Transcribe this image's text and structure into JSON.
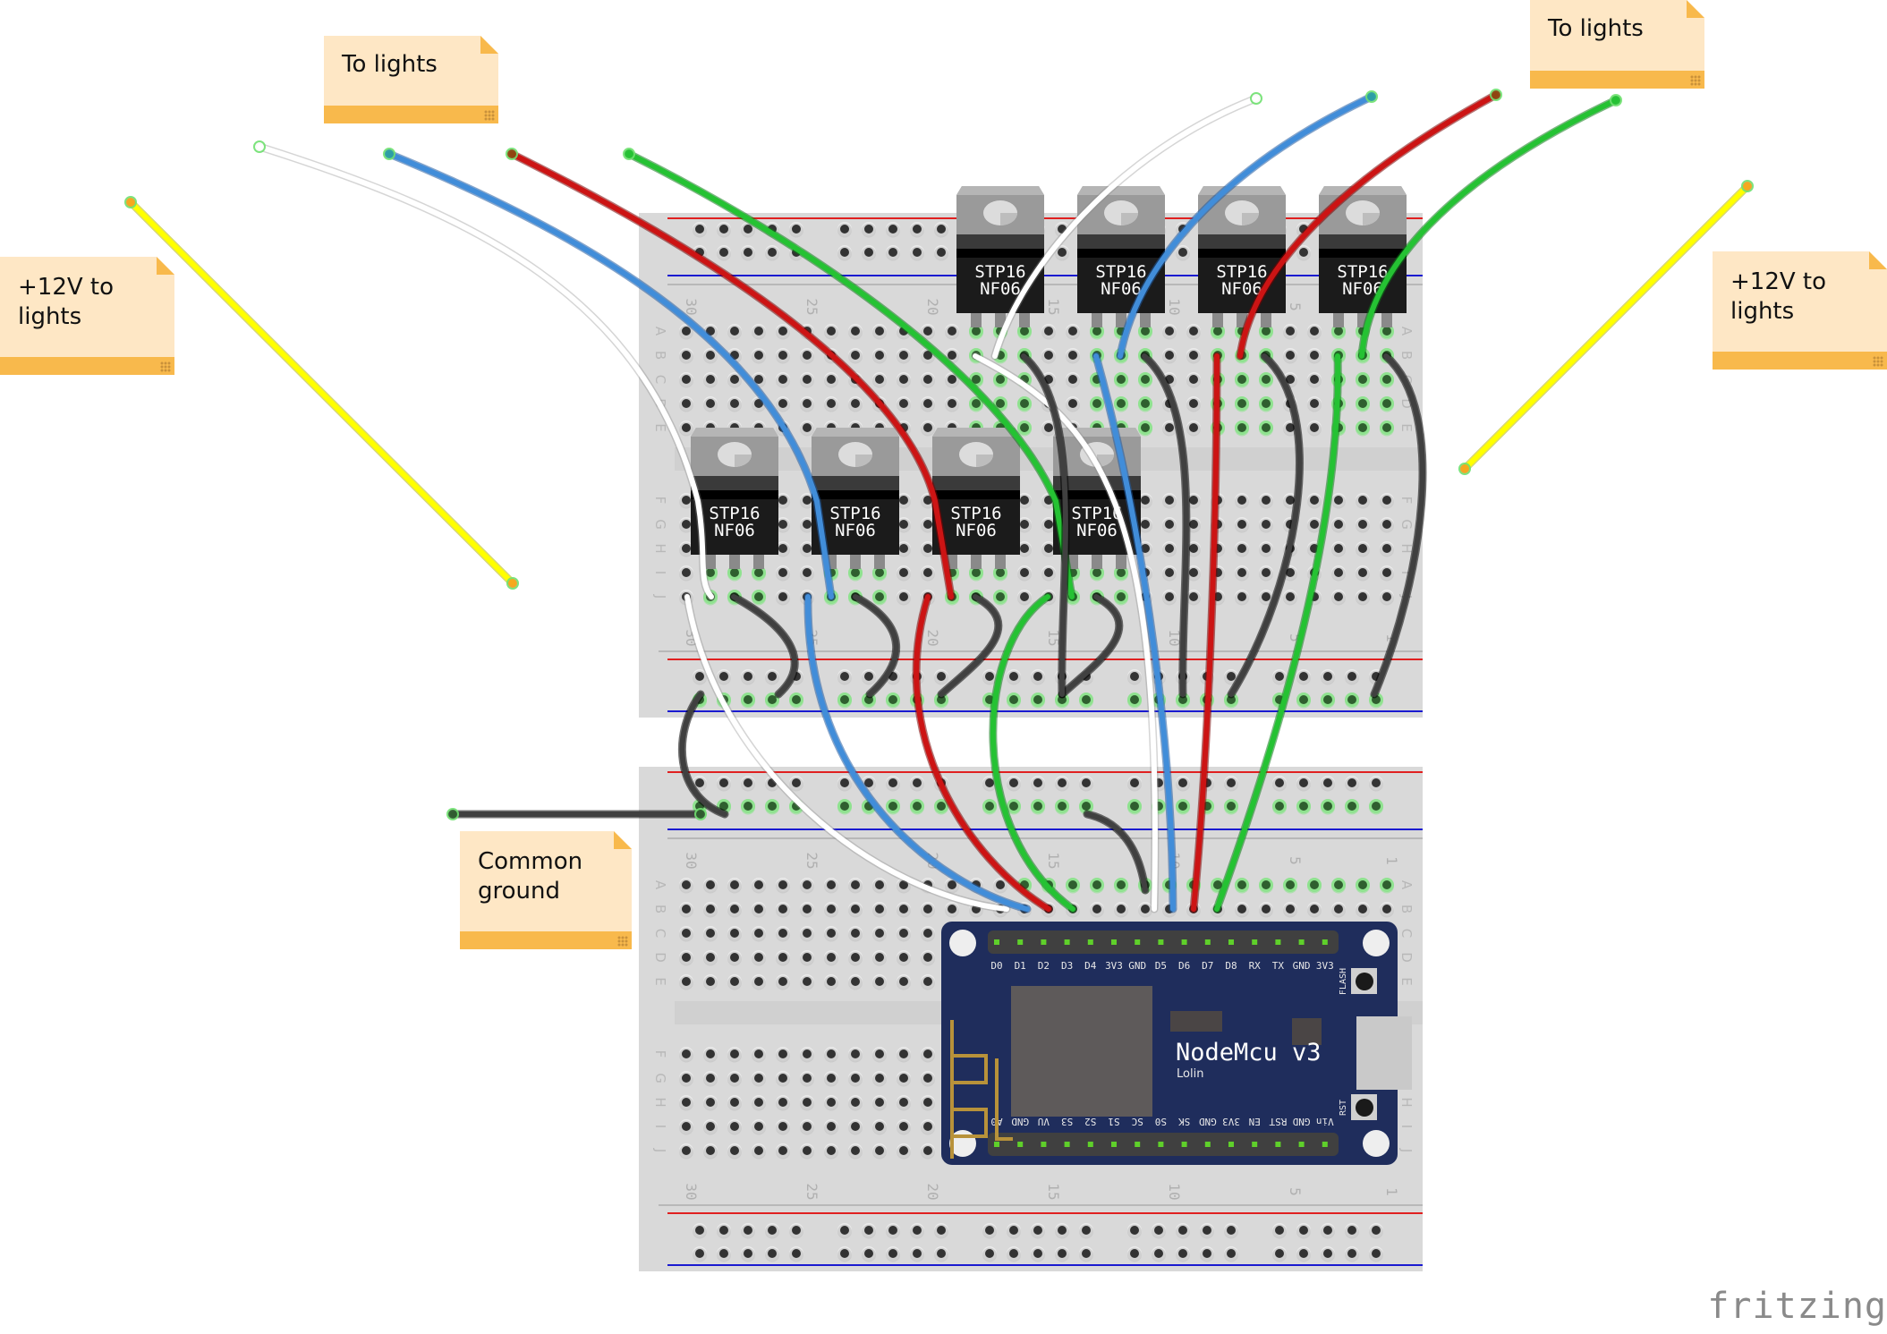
{
  "app": {
    "logo": "fritzing"
  },
  "notes": [
    {
      "id": "note-to-lights-left",
      "text": "To lights"
    },
    {
      "id": "note-12v-left",
      "text": "+12V to\nlights"
    },
    {
      "id": "note-to-lights-right",
      "text": "To lights"
    },
    {
      "id": "note-12v-right",
      "text": "+12V to\nlights"
    },
    {
      "id": "note-common-ground",
      "text": "Common\nground"
    }
  ],
  "transistors": {
    "part": "STP16NF06",
    "label_line1": "STP16",
    "label_line2": "NF06",
    "count": 8
  },
  "breadboards": {
    "column_labels": [
      "30",
      "25",
      "20",
      "15",
      "10",
      "5",
      "1"
    ],
    "row_labels_top": [
      "A",
      "B",
      "C",
      "D",
      "E"
    ],
    "row_labels_bottom": [
      "F",
      "G",
      "H",
      "I",
      "J"
    ]
  },
  "nodemcu": {
    "title": "NodeMcu v3",
    "subtitle": "Lolin",
    "top_pins": [
      "D0",
      "D1",
      "D2",
      "D3",
      "D4",
      "3V3",
      "GND",
      "D5",
      "D6",
      "D7",
      "D8",
      "RX",
      "TX",
      "GND",
      "3V3"
    ],
    "bottom_pins": [
      "A0",
      "GND",
      "VU",
      "S3",
      "S2",
      "S1",
      "SC",
      "S0",
      "SK",
      "GND",
      "3V3",
      "EN",
      "RST",
      "GND",
      "Vin"
    ],
    "flash_label": "FLASH",
    "rst_label": "RST"
  },
  "wire_colors": {
    "white": "#ffffff",
    "blue": "#418dd9",
    "red": "#cc1414",
    "green": "#25c233",
    "black": "#404040",
    "yellow": "#ffff00"
  },
  "colors": {
    "breadboard": "#d9d9d9",
    "note_bg": "#fee7c5",
    "note_footer": "#f8b94c",
    "pcb": "#1f2d5c",
    "rail_red": "#e02020",
    "rail_blue": "#1a1ad0"
  }
}
